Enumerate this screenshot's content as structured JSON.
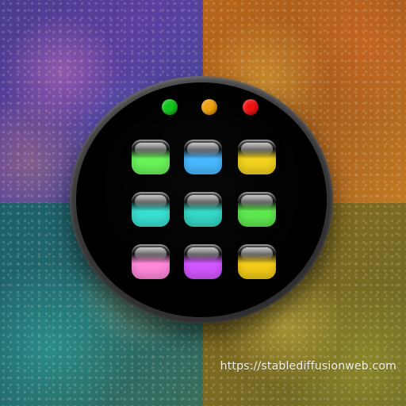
{
  "scene": {
    "quadrant_colors": {
      "top_left": "#4a3c8f",
      "top_right": "#b9661a",
      "bottom_left": "#1e5f6b",
      "bottom_right": "#8a6a1b"
    },
    "device": {
      "dots": [
        {
          "name": "green-dot",
          "color": "#12c51b"
        },
        {
          "name": "orange-dot",
          "color": "#f0a010"
        },
        {
          "name": "red-dot",
          "color": "#f01212"
        }
      ],
      "tiles": [
        {
          "name": "green-tile",
          "color": "#69f25a"
        },
        {
          "name": "blue-tile",
          "color": "#49b8ff"
        },
        {
          "name": "yellow-tile",
          "color": "#f1d21f"
        },
        {
          "name": "aqua-tile",
          "color": "#39dfd1"
        },
        {
          "name": "teal-tile",
          "color": "#35d7c5"
        },
        {
          "name": "lime-tile",
          "color": "#5ee84f"
        },
        {
          "name": "pink-tile",
          "color": "#ff88da"
        },
        {
          "name": "purple-tile",
          "color": "#d356ff"
        },
        {
          "name": "gold-tile",
          "color": "#f3cb19"
        }
      ]
    }
  },
  "watermark": {
    "text": "https://stablediffusionweb.com"
  }
}
